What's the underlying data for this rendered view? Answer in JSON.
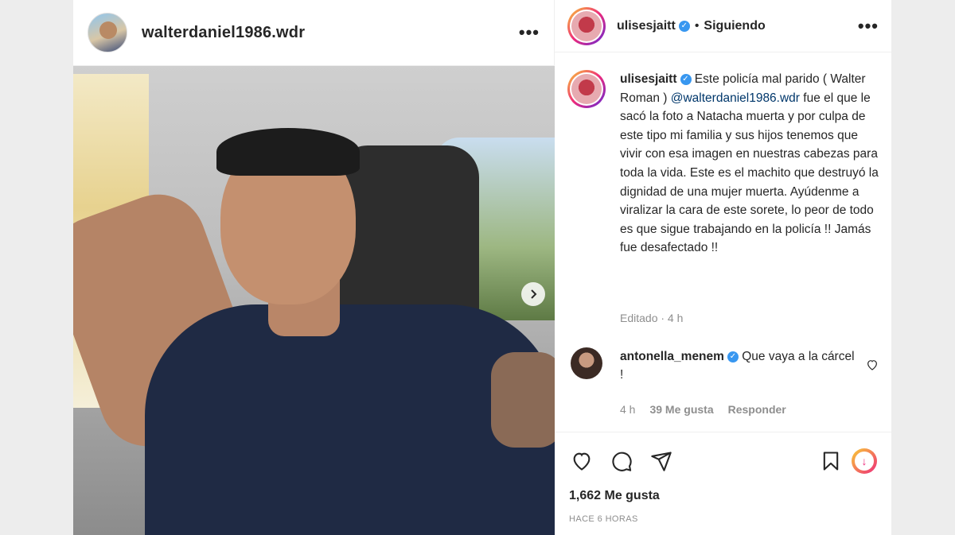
{
  "left": {
    "username": "walterdaniel1986.wdr",
    "more_label": "•••"
  },
  "right": {
    "header": {
      "username": "ulisesjaitt",
      "separator": "•",
      "follow_status": "Siguiendo",
      "more_label": "•••"
    },
    "caption": {
      "username": "ulisesjaitt",
      "text_before": " Este policía mal parido ( Walter Roman ) ",
      "mention": "@walterdaniel1986.wdr",
      "text_after": " fue el que le sacó la foto a Natacha muerta y por culpa de este tipo mi familia y sus hijos tenemos que vivir con esa imagen en nuestras cabezas para toda la vida. Este es el machito que destruyó la dignidad de una mujer muerta. Ayúdenme a viralizar la cara de este sorete, lo peor de todo es que sigue trabajando en la policía !! Jamás fue desafectado !!",
      "meta": "Editado · 4 h"
    },
    "comment": {
      "username": "antonella_menem",
      "text": " Que vaya a la cárcel !",
      "time": "4 h",
      "likes": "39 Me gusta",
      "reply": "Responder"
    },
    "likes_count": "1,662 Me gusta",
    "posted_ago": "HACE 6 HORAS"
  },
  "colors": {
    "verified": "#3897f0",
    "mention": "#00376b",
    "muted": "#8e8e8e"
  }
}
